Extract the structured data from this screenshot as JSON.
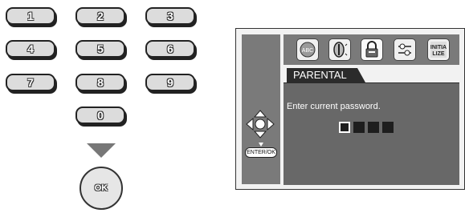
{
  "keypad": {
    "keys": [
      "1",
      "2",
      "3",
      "4",
      "5",
      "6",
      "7",
      "8",
      "9",
      "0"
    ],
    "ok_label": "OK"
  },
  "osd": {
    "menu_icons": [
      "language-icon",
      "audio-icon",
      "lock-icon",
      "settings-icon",
      "initialize-icon"
    ],
    "initialize_text": "INITIA\nLIZE",
    "tab_label": "PARENTAL",
    "prompt": "Enter current password.",
    "password_boxes": 4,
    "enter_label": "ENTER/OK"
  },
  "colors": {
    "panel_gray": "#7a7a7a",
    "content_gray": "#686868",
    "tab_dark": "#2b2b2b"
  }
}
